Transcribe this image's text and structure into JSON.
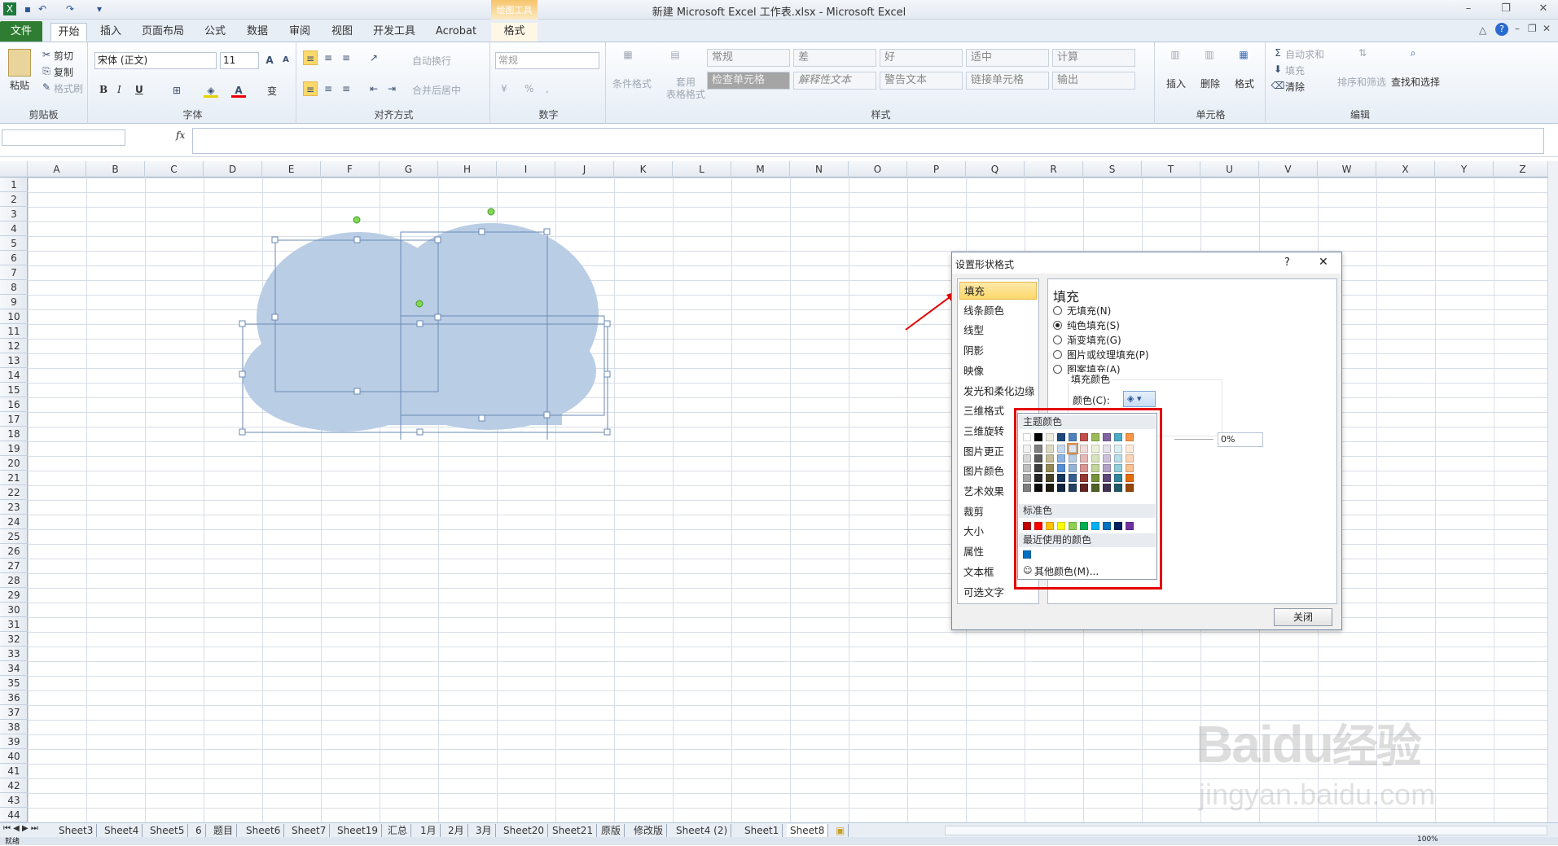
{
  "window": {
    "title": "新建 Microsoft Excel 工作表.xlsx - Microsoft Excel",
    "contextual_tab_group": "绘图工具"
  },
  "tabs": [
    {
      "label": "文件"
    },
    {
      "label": "开始"
    },
    {
      "label": "插入"
    },
    {
      "label": "页面布局"
    },
    {
      "label": "公式"
    },
    {
      "label": "数据"
    },
    {
      "label": "审阅"
    },
    {
      "label": "视图"
    },
    {
      "label": "开发工具"
    },
    {
      "label": "Acrobat"
    },
    {
      "label": "格式"
    }
  ],
  "ribbon": {
    "clipboard": {
      "paste": "粘贴",
      "cut": "剪切",
      "copy": "复制",
      "format_painter": "格式刷",
      "group": "剪贴板"
    },
    "font": {
      "name": "宋体 (正文)",
      "size": "11",
      "bold": "B",
      "italic": "I",
      "underline": "U",
      "phonetic": "变",
      "group": "字体"
    },
    "alignment": {
      "wrap": "自动换行",
      "merge": "合并后居中",
      "group": "对齐方式"
    },
    "number": {
      "format": "常规",
      "percent": "%",
      "comma": ",",
      "group": "数字"
    },
    "styles": {
      "conditional": "条件格式",
      "table_format": "套用\n表格格式",
      "cells": [
        "常规",
        "差",
        "好",
        "适中",
        "计算",
        "检查单元格",
        "解释性文本",
        "警告文本",
        "链接单元格",
        "输出"
      ],
      "group": "样式"
    },
    "cells_group": {
      "insert": "插入",
      "delete": "删除",
      "format": "格式",
      "group": "单元格"
    },
    "editing": {
      "autosum": "自动求和",
      "fill": "填充",
      "clear": "清除",
      "sort": "排序和筛选",
      "find": "查找和选择",
      "group": "编辑"
    }
  },
  "formula_bar": {
    "name_box": "",
    "fx": "fx",
    "value": ""
  },
  "columns": [
    "A",
    "B",
    "C",
    "D",
    "E",
    "F",
    "G",
    "H",
    "I",
    "J",
    "K",
    "L",
    "M",
    "N",
    "O",
    "P",
    "Q",
    "R",
    "S",
    "T",
    "U",
    "V",
    "W",
    "X",
    "Y",
    "Z"
  ],
  "rows": [
    "1",
    "2",
    "3",
    "4",
    "5",
    "6",
    "7",
    "8",
    "9",
    "10",
    "11",
    "12",
    "13",
    "14",
    "15",
    "16",
    "17",
    "18",
    "19",
    "20",
    "21",
    "22",
    "23",
    "24",
    "25",
    "26",
    "27",
    "28",
    "29",
    "30",
    "31",
    "32",
    "33",
    "34",
    "35",
    "36",
    "37",
    "38",
    "39",
    "40",
    "41",
    "42",
    "43",
    "44"
  ],
  "sheets": [
    "Sheet3",
    "Sheet4",
    "Sheet5",
    "6",
    "题目",
    "Sheet6",
    "Sheet7",
    "Sheet19",
    "汇总",
    "1月",
    "2月",
    "3月",
    "Sheet20",
    "Sheet21",
    "原版",
    "修改版",
    "Sheet4 (2)",
    "Sheet1",
    "Sheet8"
  ],
  "active_sheet": "Sheet8",
  "status": {
    "ready": "就绪",
    "zoom": "100%"
  },
  "shape": {
    "fill_color": "#b9cde5",
    "outline_color": "#6a8ab5",
    "handle_color": "#7ed957"
  },
  "dialog": {
    "title": "设置形状格式",
    "help": "?",
    "close_x": "✕",
    "nav": [
      "填充",
      "线条颜色",
      "线型",
      "阴影",
      "映像",
      "发光和柔化边缘",
      "三维格式",
      "三维旋转",
      "图片更正",
      "图片颜色",
      "艺术效果",
      "裁剪",
      "大小",
      "属性",
      "文本框",
      "可选文字"
    ],
    "selected_nav": "填充",
    "panel_title": "填充",
    "options": [
      {
        "label": "无填充(N)",
        "checked": false
      },
      {
        "label": "纯色填充(S)",
        "checked": true
      },
      {
        "label": "渐变填充(G)",
        "checked": false
      },
      {
        "label": "图片或纹理填充(P)",
        "checked": false
      },
      {
        "label": "图案填充(A)",
        "checked": false
      }
    ],
    "fill_color_section": "填充颜色",
    "color_label": "颜色(C):",
    "transparency": "0%",
    "close_button": "关闭"
  },
  "color_popup": {
    "theme_header": "主题颜色",
    "standard_header": "标准色",
    "recent_header": "最近使用的颜色",
    "more_colors": "其他颜色(M)...",
    "theme_top": [
      "#ffffff",
      "#000000",
      "#eeece1",
      "#1f497d",
      "#4f81bd",
      "#c0504d",
      "#9bbb59",
      "#8064a2",
      "#4bacc6",
      "#f79646"
    ],
    "theme_shades": [
      [
        "#f2f2f2",
        "#7f7f7f",
        "#ddd9c3",
        "#c6d9f0",
        "#dbe5f1",
        "#f2dcdb",
        "#ebf1dd",
        "#e5e0ec",
        "#dbeef3",
        "#fdeada"
      ],
      [
        "#d8d8d8",
        "#595959",
        "#c4bd97",
        "#8db3e2",
        "#b8cce4",
        "#e5b9b7",
        "#d7e3bc",
        "#ccc1d9",
        "#b7dde8",
        "#fbd5b5"
      ],
      [
        "#bfbfbf",
        "#3f3f3f",
        "#938953",
        "#548dd4",
        "#95b3d7",
        "#d99694",
        "#c3d69b",
        "#b2a2c7",
        "#92cddc",
        "#fac08f"
      ],
      [
        "#a5a5a5",
        "#262626",
        "#494429",
        "#17365d",
        "#366092",
        "#953734",
        "#76923c",
        "#5f497a",
        "#31859b",
        "#e36c09"
      ],
      [
        "#7f7f7f",
        "#0c0c0c",
        "#1d1b10",
        "#0f243e",
        "#244061",
        "#632423",
        "#4f6128",
        "#3f3151",
        "#205867",
        "#974806"
      ]
    ],
    "standard": [
      "#c00000",
      "#ff0000",
      "#ffc000",
      "#ffff00",
      "#92d050",
      "#00b050",
      "#00b0f0",
      "#0070c0",
      "#002060",
      "#7030a0"
    ],
    "recent": [
      "#0070c0"
    ]
  },
  "watermark": {
    "brand": "Bai",
    "brand2": "du",
    "cn": "经验",
    "url": "jingyan.baidu.com"
  }
}
